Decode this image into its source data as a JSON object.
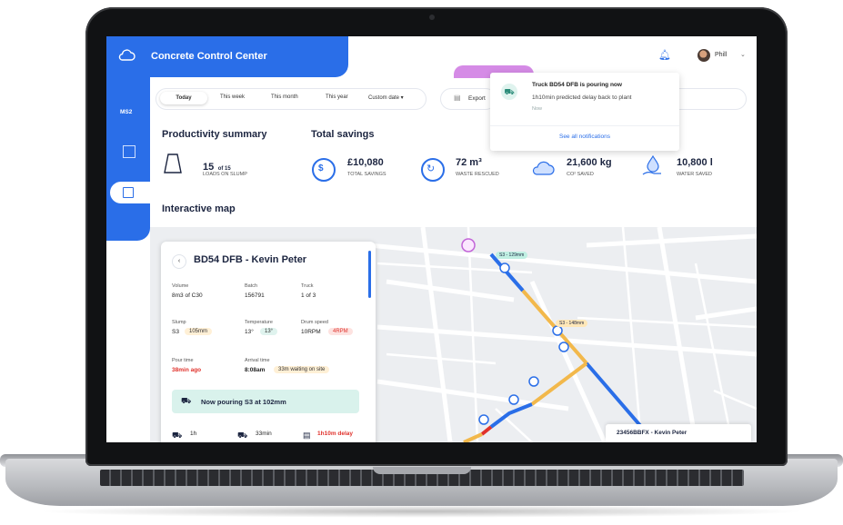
{
  "app": {
    "title": "Concrete Control Center",
    "user": "Phill",
    "side_label": "MS2"
  },
  "filters": [
    "Today",
    "This week",
    "This month",
    "This year",
    "Custom date ▾"
  ],
  "export_label": "Export",
  "notification": {
    "title": "Truck BD54 DFB is pouring now",
    "body": "1h10min predicted delay back to plant",
    "time": "Now",
    "link": "See all notifications"
  },
  "productivity": {
    "heading": "Productivity summary",
    "value": "15",
    "of": "of 15",
    "sub": "LOADS ON SLUMP"
  },
  "savings": {
    "heading": "Total savings",
    "items": [
      {
        "value": "£10,080",
        "sub": "TOTAL SAVINGS",
        "icon": "coin-icon"
      },
      {
        "value": "72 m³",
        "sub": "WASTE RESCUED",
        "icon": "recycle-icon"
      },
      {
        "value": "21,600 kg",
        "sub": "CO² SAVED",
        "icon": "cloud-icon"
      },
      {
        "value": "10,800 l",
        "sub": "WATER SAVED",
        "icon": "water-hand-icon"
      }
    ]
  },
  "map_heading": "Interactive map",
  "truck_card": {
    "title": "BD54 DFB - Kevin Peter",
    "fields": [
      {
        "label": "Volume",
        "value": "8m3 of C30"
      },
      {
        "label": "Batch",
        "value": "156791"
      },
      {
        "label": "Truck",
        "value": "1 of 3"
      },
      {
        "label": "Slump",
        "value": "S3",
        "pill": "105mm"
      },
      {
        "label": "Temperature",
        "value": "13°",
        "pill": "13°"
      },
      {
        "label": "Drum speed",
        "value": "10RPM",
        "pill": "4RPM"
      },
      {
        "label": "Pour time",
        "value": "38min ago"
      },
      {
        "label": "Arrival time",
        "value": "8:08am",
        "pill": "33m waiting on site"
      }
    ],
    "banner": "Now pouring S3 at 102mm",
    "bottom": [
      {
        "value": "1h"
      },
      {
        "value": "33min"
      },
      {
        "value": "1h10m delay"
      }
    ]
  },
  "map_labels": {
    "bubble_1": "S3 - 129mm",
    "bubble_2": "S3 - 148mm",
    "bottom_tag": "23456BBFX - Kevin Peter"
  },
  "colors": {
    "brand": "#2a6ee8",
    "route_orange": "#f2b84b",
    "route_blue": "#2a6ee8",
    "alert": "#e0312b",
    "teal": "#d9f2ec"
  }
}
